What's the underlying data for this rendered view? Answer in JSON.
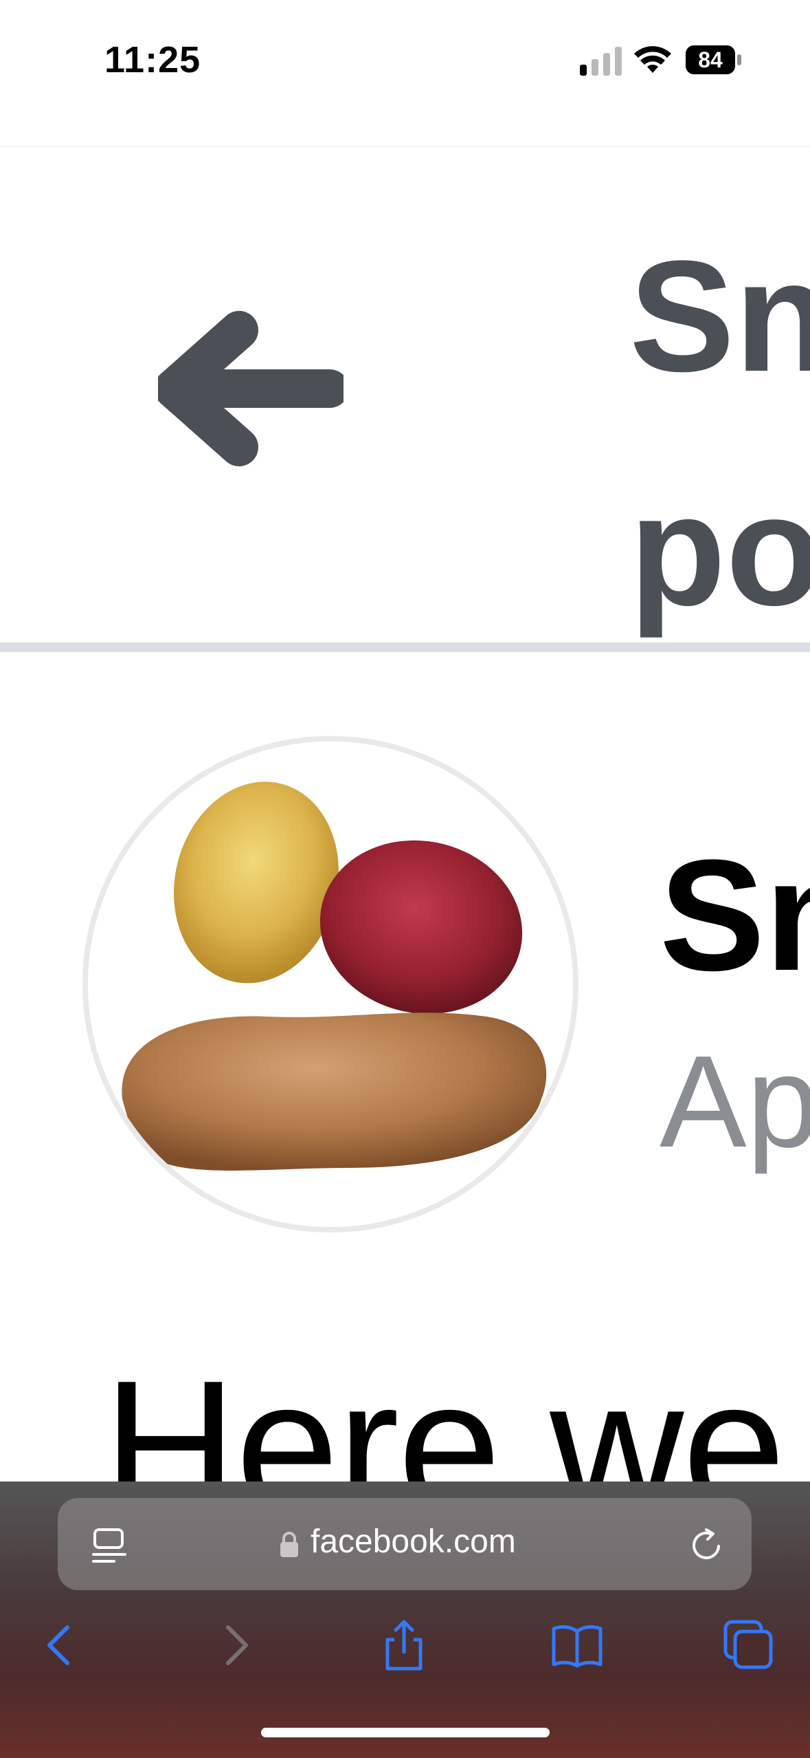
{
  "status_bar": {
    "time": "11:25",
    "battery": "84"
  },
  "header": {
    "title": "Sn\npo",
    "back_icon": "arrow-left-icon"
  },
  "post": {
    "author": "Sn",
    "date": "Ap",
    "text": "Here we o"
  },
  "browser": {
    "url": "facebook.com",
    "icons": [
      "reader-icon",
      "lock-icon",
      "reload-icon",
      "back-chevron-icon",
      "forward-chevron-icon",
      "share-icon",
      "bookmarks-icon",
      "tabs-icon"
    ]
  },
  "colors": {
    "header_text": "#4b4f56",
    "date_text": "#8a8d91",
    "accent_blue": "#3478f6",
    "divider": "#dadde1"
  }
}
